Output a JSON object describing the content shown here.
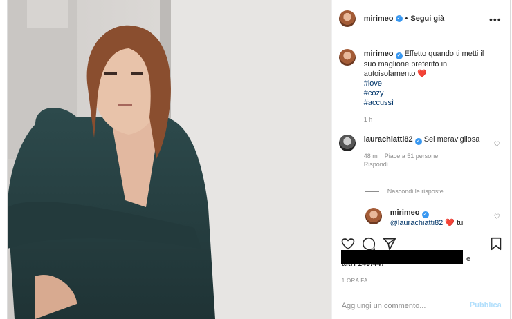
{
  "header": {
    "username": "mirimeo",
    "separator": "•",
    "follow_label": "Segui già",
    "more_label": "•••"
  },
  "caption": {
    "username": "mirimeo",
    "text": "Effetto quando ti metti il suo maglione preferito in autoisolamento",
    "heart": "❤️",
    "hashtags": [
      "#love",
      "#cozy",
      "#accussì"
    ],
    "time": "1 h"
  },
  "comment": {
    "username": "laurachiatti82",
    "text": "Sei meravigliosa",
    "time": "48 m",
    "likes": "Piace a 51 persone",
    "reply_label": "Rispondi"
  },
  "hide_replies_label": "Nascondi le risposte",
  "reply": {
    "username": "mirimeo",
    "mention": "@laurachiatti82",
    "heart": "❤️",
    "text": "tu"
  },
  "likes": {
    "suffix": "e",
    "count_text": "altri 149.447"
  },
  "posted_ago": "1 ORA FA",
  "add_comment": {
    "placeholder": "Aggiungi un commento...",
    "publish_label": "Pubblica"
  },
  "colors": {
    "accent": "#3897f0",
    "publish_disabled": "#b2dffc",
    "heart": "#ed4956",
    "hashtag": "#003569"
  }
}
